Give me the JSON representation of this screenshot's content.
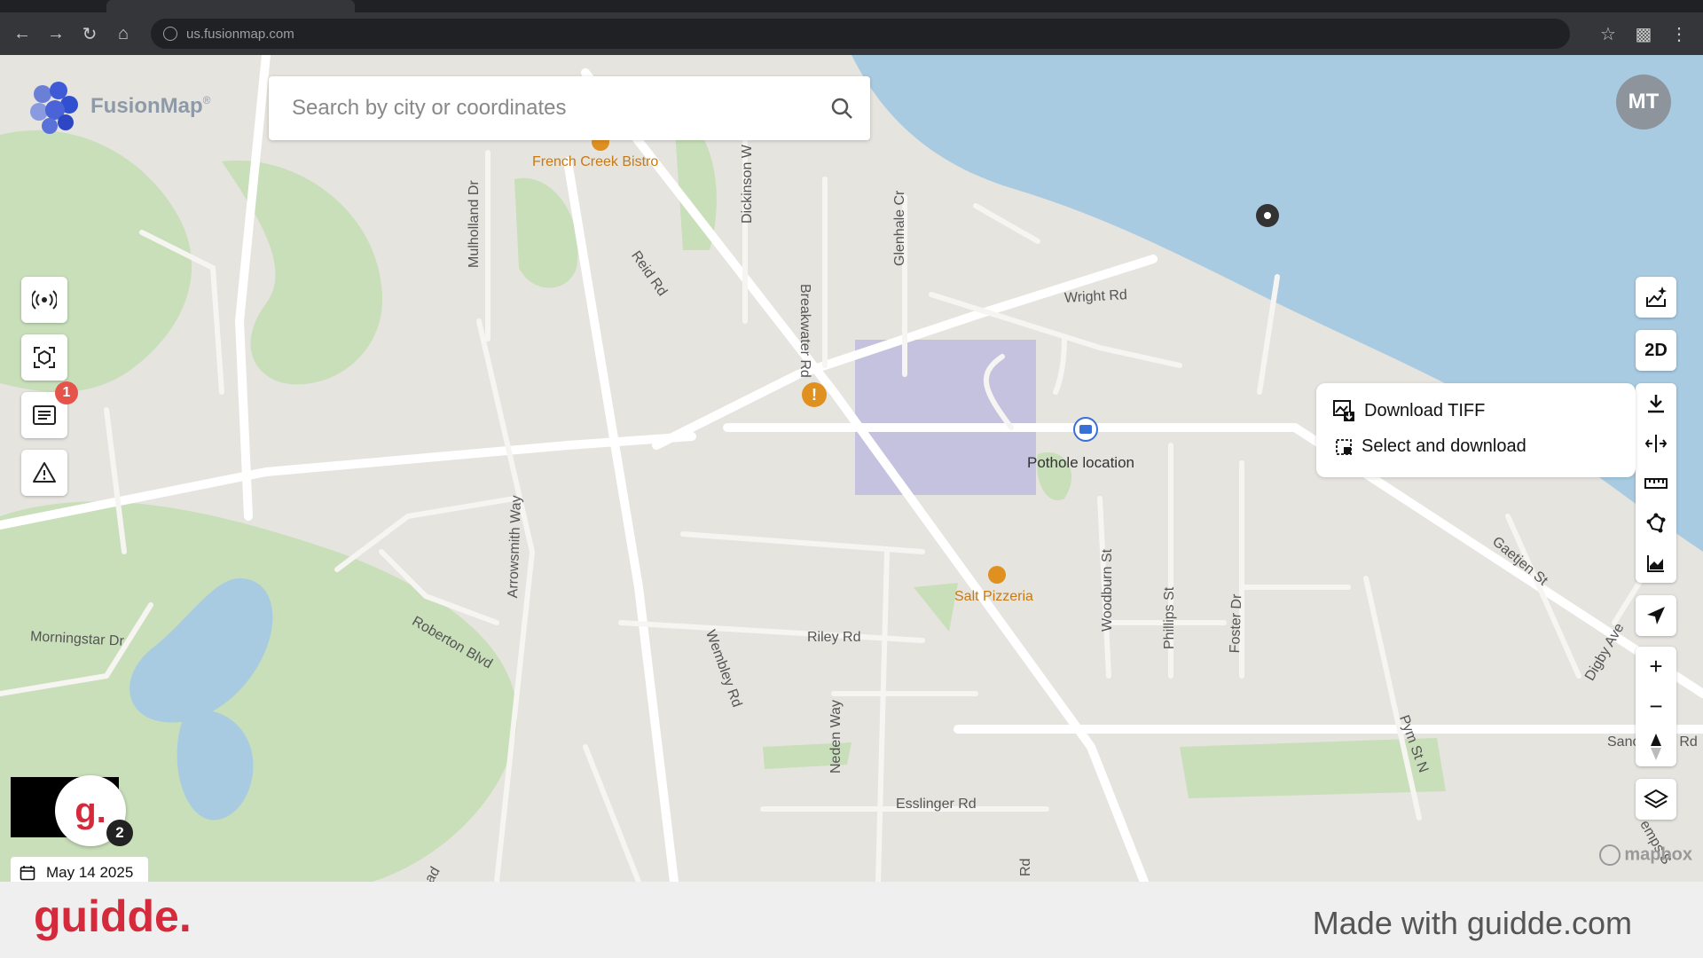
{
  "browser": {
    "url": "us.fusionmap.com",
    "nav_icons": [
      "back-arrow-icon",
      "forward-arrow-icon",
      "reload-icon",
      "home-icon"
    ],
    "right_icons": [
      "star-icon",
      "puzzle-icon",
      "kebab-menu-icon"
    ]
  },
  "app": {
    "logo_text": "FusionMap",
    "logo_mark": "®",
    "search_placeholder": "Search by city or coordinates",
    "avatar_initials": "MT"
  },
  "left_toolbar": [
    {
      "icon": "broadcast-icon"
    },
    {
      "icon": "ai-scan-icon"
    },
    {
      "icon": "messages-icon",
      "badge": "1"
    },
    {
      "icon": "warning-icon"
    }
  ],
  "right_toolbar": {
    "ai_icon": "sparkle-layers-icon",
    "view_mode": "2D",
    "tools": [
      "download-icon",
      "compare-icon",
      "ruler-icon",
      "polygon-icon",
      "elevation-chart-icon"
    ],
    "locate_icon": "navigation-arrow-icon",
    "zoom": [
      "plus-icon",
      "minus-icon",
      "compass-icon"
    ],
    "layers_icon": "layers-icon"
  },
  "download_menu": {
    "items": [
      {
        "label": "Download TIFF",
        "icon": "tiff-download-icon"
      },
      {
        "label": "Select and download",
        "icon": "select-area-icon"
      }
    ]
  },
  "map": {
    "colors": {
      "land": "#e6e4df",
      "water": "#a8cbe2",
      "park": "#c8dfba",
      "road": "#ffffff",
      "selection": "#b7b4e0",
      "poi": "#e0901e"
    },
    "road_labels": [
      "Mulholland Dr",
      "Dickinson W",
      "Breakwater Rd",
      "Glenhale Cr",
      "Reid Rd",
      "Wright Rd",
      "Arrowsmith Way",
      "Roberton Blvd",
      "Morningstar Dr",
      "Wembley Rd",
      "Riley Rd",
      "Neden Way",
      "Esslinger Rd",
      "Woodburn St",
      "Phillips St",
      "Foster Dr",
      "Gaetjen St",
      "Digby Ave",
      "Pym St N",
      "Sanc",
      "n Rd",
      "Rd",
      "ad",
      "emps S"
    ],
    "pois": [
      {
        "name": "French Creek Bistro",
        "type": "restaurant"
      },
      {
        "name": "Salt Pizzeria",
        "type": "restaurant"
      }
    ],
    "markers": [
      {
        "label": "Pothole location",
        "icon": "message-pin-icon"
      },
      {
        "label": "",
        "icon": "warning-pin-icon"
      },
      {
        "label": "",
        "icon": "location-pin-icon"
      }
    ],
    "attribution": "mapbox"
  },
  "date_chip": {
    "label": "May 14 2025",
    "icon": "calendar-icon"
  },
  "guidde_widget": {
    "letter": "g.",
    "count": "2"
  },
  "footer": {
    "logo": "guidde.",
    "text": "Made with guidde.com"
  }
}
